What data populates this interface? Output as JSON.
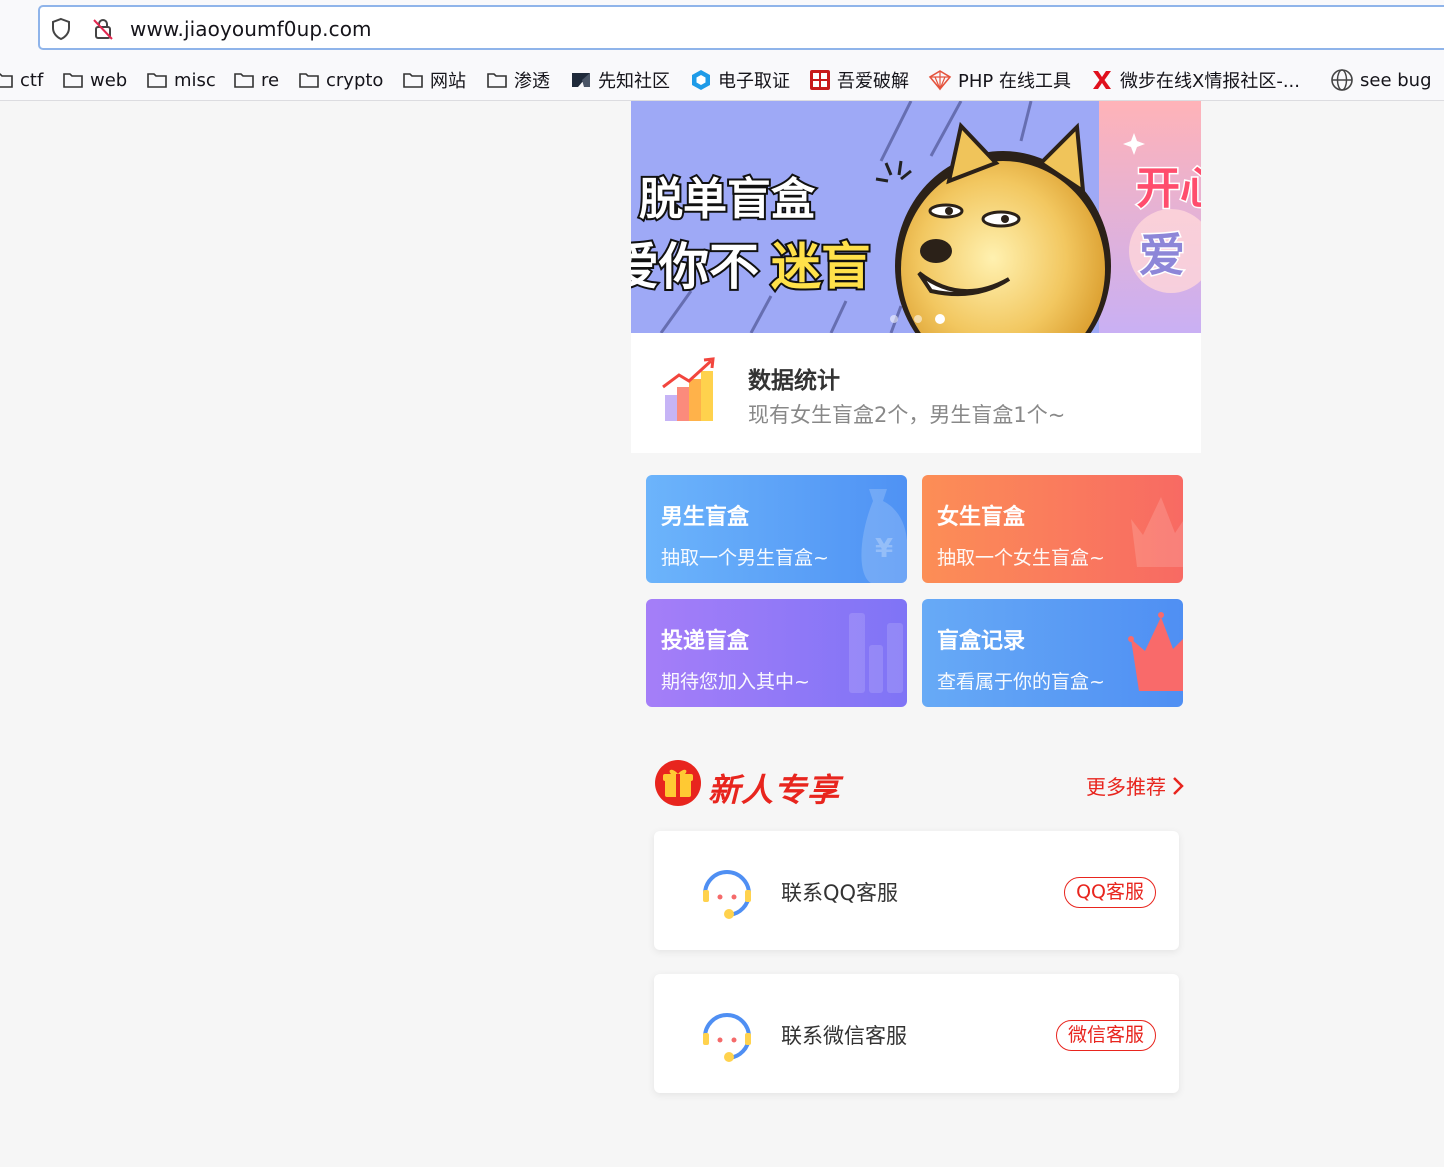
{
  "browser": {
    "url": "www.jiaoyoumf0up.com",
    "bookmarks": [
      {
        "label": "ctf",
        "icon": "folder-icon"
      },
      {
        "label": "web",
        "icon": "folder-icon"
      },
      {
        "label": "misc",
        "icon": "folder-icon"
      },
      {
        "label": "re",
        "icon": "folder-icon"
      },
      {
        "label": "crypto",
        "icon": "folder-icon"
      },
      {
        "label": "网站",
        "icon": "folder-icon"
      },
      {
        "label": "渗透",
        "icon": "folder-icon"
      },
      {
        "label": "先知社区",
        "icon": "xianzhi-icon"
      },
      {
        "label": "电子取证",
        "icon": "forensics-icon"
      },
      {
        "label": "吾爱破解",
        "icon": "52pojie-icon"
      },
      {
        "label": "PHP 在线工具",
        "icon": "php-tool-icon"
      },
      {
        "label": "微步在线X情报社区-...",
        "icon": "threatbook-icon"
      },
      {
        "label": "see bug",
        "icon": "globe-icon"
      }
    ]
  },
  "banner": {
    "line1": "脱单盲盒",
    "line2_a": "爱你不",
    "line2_b": "迷盲",
    "side_a": "开心",
    "side_b": "爱"
  },
  "stats": {
    "title": "数据统计",
    "subtitle": "现有女生盲盒2个，男生盲盒1个~"
  },
  "cards": [
    {
      "title": "男生盲盒",
      "subtitle": "抽取一个男生盲盒~"
    },
    {
      "title": "女生盲盒",
      "subtitle": "抽取一个女生盲盒~"
    },
    {
      "title": "投递盲盒",
      "subtitle": "期待您加入其中~"
    },
    {
      "title": "盲盒记录",
      "subtitle": "查看属于你的盲盒~"
    }
  ],
  "promo": {
    "title": "新人专享",
    "more": "更多推荐"
  },
  "services": [
    {
      "label": "联系QQ客服",
      "button": "QQ客服"
    },
    {
      "label": "联系微信客服",
      "button": "微信客服"
    }
  ],
  "colors": {
    "accent_red": "#e8251e",
    "male_card": "#5a9ef7",
    "female_card": "#f97a5d",
    "post_card": "#9179f7",
    "record_card": "#5b9bf5"
  }
}
